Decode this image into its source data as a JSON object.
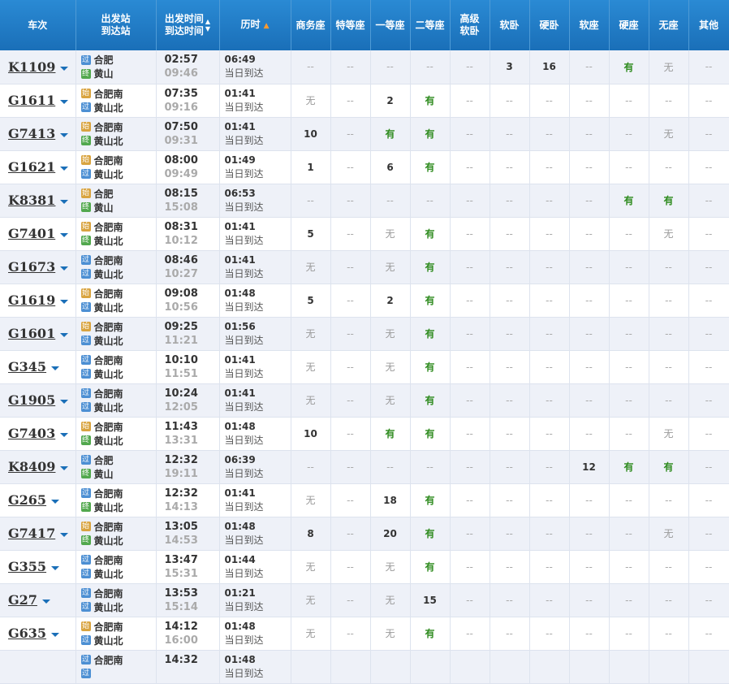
{
  "header": {
    "train": "车次",
    "stations_line1": "出发站",
    "stations_line2": "到达站",
    "time_line1": "出发时间",
    "time_line2": "到达时间",
    "duration": "历时",
    "seats": [
      "商务座",
      "特等座",
      "一等座",
      "二等座",
      "高级软卧",
      "软卧",
      "硬卧",
      "软座",
      "硬座",
      "无座",
      "其他"
    ]
  },
  "badge_labels": {
    "start": "始",
    "pass": "过",
    "end": "终"
  },
  "same_day_label": "当日到达",
  "dash": "--",
  "rows": [
    {
      "train": "K1109",
      "from": "合肥",
      "from_badge": "pass",
      "to": "黄山",
      "to_badge": "end",
      "dep": "02:57",
      "arr": "09:46",
      "duration": "06:49",
      "seats": [
        "--",
        "--",
        "--",
        "--",
        "--",
        "3",
        "16",
        "--",
        "有",
        "无",
        "--"
      ]
    },
    {
      "train": "G1611",
      "from": "合肥南",
      "from_badge": "start",
      "to": "黄山北",
      "to_badge": "pass",
      "dep": "07:35",
      "arr": "09:16",
      "duration": "01:41",
      "seats": [
        "无",
        "--",
        "2",
        "有",
        "--",
        "--",
        "--",
        "--",
        "--",
        "--",
        "--"
      ]
    },
    {
      "train": "G7413",
      "from": "合肥南",
      "from_badge": "start",
      "to": "黄山北",
      "to_badge": "end",
      "dep": "07:50",
      "arr": "09:31",
      "duration": "01:41",
      "seats": [
        "10",
        "--",
        "有",
        "有",
        "--",
        "--",
        "--",
        "--",
        "--",
        "无",
        "--"
      ]
    },
    {
      "train": "G1621",
      "from": "合肥南",
      "from_badge": "start",
      "to": "黄山北",
      "to_badge": "pass",
      "dep": "08:00",
      "arr": "09:49",
      "duration": "01:49",
      "seats": [
        "1",
        "--",
        "6",
        "有",
        "--",
        "--",
        "--",
        "--",
        "--",
        "--",
        "--"
      ]
    },
    {
      "train": "K8381",
      "from": "合肥",
      "from_badge": "start",
      "to": "黄山",
      "to_badge": "end",
      "dep": "08:15",
      "arr": "15:08",
      "duration": "06:53",
      "seats": [
        "--",
        "--",
        "--",
        "--",
        "--",
        "--",
        "--",
        "--",
        "有",
        "有",
        "--"
      ]
    },
    {
      "train": "G7401",
      "from": "合肥南",
      "from_badge": "start",
      "to": "黄山北",
      "to_badge": "end",
      "dep": "08:31",
      "arr": "10:12",
      "duration": "01:41",
      "seats": [
        "5",
        "--",
        "无",
        "有",
        "--",
        "--",
        "--",
        "--",
        "--",
        "无",
        "--"
      ]
    },
    {
      "train": "G1673",
      "from": "合肥南",
      "from_badge": "pass",
      "to": "黄山北",
      "to_badge": "pass",
      "dep": "08:46",
      "arr": "10:27",
      "duration": "01:41",
      "seats": [
        "无",
        "--",
        "无",
        "有",
        "--",
        "--",
        "--",
        "--",
        "--",
        "--",
        "--"
      ]
    },
    {
      "train": "G1619",
      "from": "合肥南",
      "from_badge": "start",
      "to": "黄山北",
      "to_badge": "pass",
      "dep": "09:08",
      "arr": "10:56",
      "duration": "01:48",
      "seats": [
        "5",
        "--",
        "2",
        "有",
        "--",
        "--",
        "--",
        "--",
        "--",
        "--",
        "--"
      ]
    },
    {
      "train": "G1601",
      "from": "合肥南",
      "from_badge": "start",
      "to": "黄山北",
      "to_badge": "pass",
      "dep": "09:25",
      "arr": "11:21",
      "duration": "01:56",
      "seats": [
        "无",
        "--",
        "无",
        "有",
        "--",
        "--",
        "--",
        "--",
        "--",
        "--",
        "--"
      ]
    },
    {
      "train": "G345",
      "from": "合肥南",
      "from_badge": "pass",
      "to": "黄山北",
      "to_badge": "pass",
      "dep": "10:10",
      "arr": "11:51",
      "duration": "01:41",
      "seats": [
        "无",
        "--",
        "无",
        "有",
        "--",
        "--",
        "--",
        "--",
        "--",
        "--",
        "--"
      ]
    },
    {
      "train": "G1905",
      "from": "合肥南",
      "from_badge": "pass",
      "to": "黄山北",
      "to_badge": "pass",
      "dep": "10:24",
      "arr": "12:05",
      "duration": "01:41",
      "seats": [
        "无",
        "--",
        "无",
        "有",
        "--",
        "--",
        "--",
        "--",
        "--",
        "--",
        "--"
      ]
    },
    {
      "train": "G7403",
      "from": "合肥南",
      "from_badge": "start",
      "to": "黄山北",
      "to_badge": "end",
      "dep": "11:43",
      "arr": "13:31",
      "duration": "01:48",
      "seats": [
        "10",
        "--",
        "有",
        "有",
        "--",
        "--",
        "--",
        "--",
        "--",
        "无",
        "--"
      ]
    },
    {
      "train": "K8409",
      "from": "合肥",
      "from_badge": "pass",
      "to": "黄山",
      "to_badge": "end",
      "dep": "12:32",
      "arr": "19:11",
      "duration": "06:39",
      "seats": [
        "--",
        "--",
        "--",
        "--",
        "--",
        "--",
        "--",
        "12",
        "有",
        "有",
        "--"
      ]
    },
    {
      "train": "G265",
      "from": "合肥南",
      "from_badge": "pass",
      "to": "黄山北",
      "to_badge": "end",
      "dep": "12:32",
      "arr": "14:13",
      "duration": "01:41",
      "seats": [
        "无",
        "--",
        "18",
        "有",
        "--",
        "--",
        "--",
        "--",
        "--",
        "--",
        "--"
      ]
    },
    {
      "train": "G7417",
      "from": "合肥南",
      "from_badge": "start",
      "to": "黄山北",
      "to_badge": "end",
      "dep": "13:05",
      "arr": "14:53",
      "duration": "01:48",
      "seats": [
        "8",
        "--",
        "20",
        "有",
        "--",
        "--",
        "--",
        "--",
        "--",
        "无",
        "--"
      ]
    },
    {
      "train": "G355",
      "from": "合肥南",
      "from_badge": "pass",
      "to": "黄山北",
      "to_badge": "pass",
      "dep": "13:47",
      "arr": "15:31",
      "duration": "01:44",
      "seats": [
        "无",
        "--",
        "无",
        "有",
        "--",
        "--",
        "--",
        "--",
        "--",
        "--",
        "--"
      ]
    },
    {
      "train": "G27",
      "from": "合肥南",
      "from_badge": "pass",
      "to": "黄山北",
      "to_badge": "pass",
      "dep": "13:53",
      "arr": "15:14",
      "duration": "01:21",
      "seats": [
        "无",
        "--",
        "无",
        "15",
        "--",
        "--",
        "--",
        "--",
        "--",
        "--",
        "--"
      ]
    },
    {
      "train": "G635",
      "from": "合肥南",
      "from_badge": "start",
      "to": "黄山北",
      "to_badge": "pass",
      "dep": "14:12",
      "arr": "16:00",
      "duration": "01:48",
      "seats": [
        "无",
        "--",
        "无",
        "有",
        "--",
        "--",
        "--",
        "--",
        "--",
        "--",
        "--"
      ]
    },
    {
      "train": "",
      "from": "合肥南",
      "from_badge": "pass",
      "to": "",
      "to_badge": "pass",
      "dep": "14:32",
      "arr": "",
      "duration": "01:48",
      "seats": [
        "",
        "",
        "",
        "",
        "",
        "",
        "",
        "",
        "",
        "",
        ""
      ]
    }
  ]
}
